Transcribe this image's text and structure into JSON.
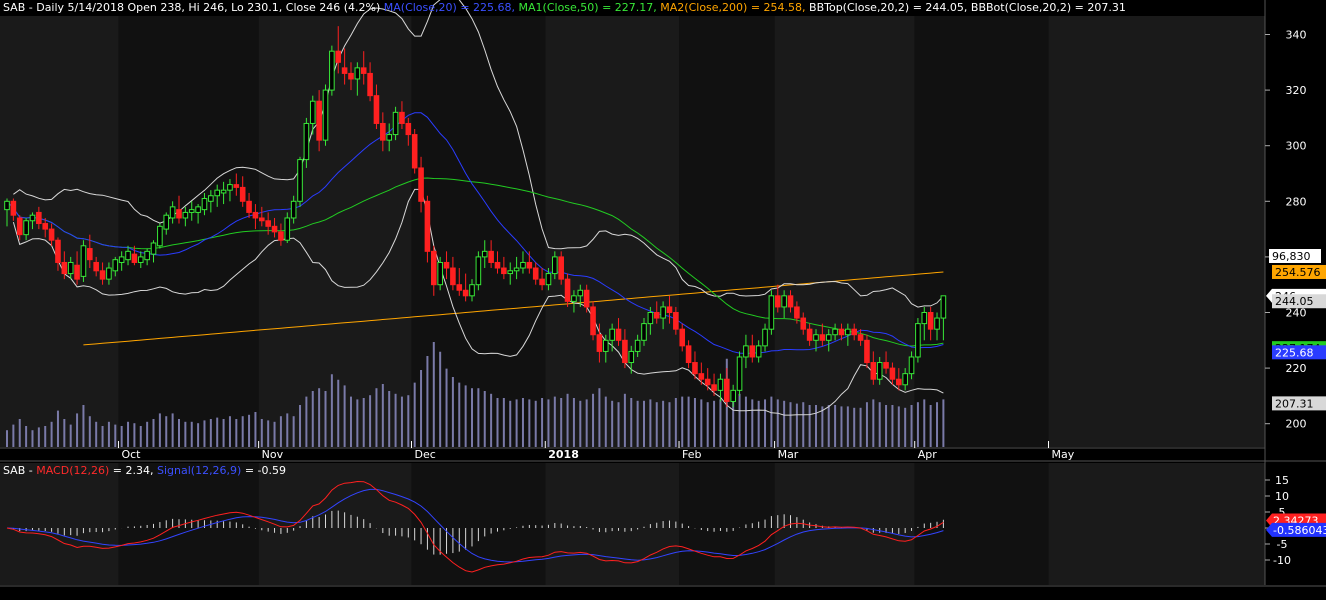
{
  "header": {
    "prefix": "SAB - Daily 5/14/2018 Open 238, Hi 246, Lo 230.1, Close 246 (4.2%) ",
    "ma": "MA(Close,20) = 225.68,",
    "ma1": " MA1(Close,50) = 227.17,",
    "ma2": " MA2(Close,200) = 254.58,",
    "bbtop": " BBTop(Close,20,2) = 244.05,",
    "bbbot": " BBBot(Close,20,2) = 207.31"
  },
  "macd_header": {
    "prefix": "SAB - ",
    "macd": "MACD(12,26)",
    "macd_val": " = 2.34, ",
    "signal": "Signal(12,26,9)",
    "signal_val": " = -0.59"
  },
  "colors": {
    "background": "#000000",
    "up": "#38e838",
    "down": "#ff2020",
    "ma20": "#2a3cff",
    "ma50": "#22cc22",
    "ma200": "#ffa500",
    "bollinger": "#d8d8d8",
    "volume": "#7a7aa8",
    "macd": "#ff2020",
    "signal": "#3344ff",
    "histogram": "#d8d8d8"
  },
  "chart_data": {
    "type": "candlestick",
    "price_axis": {
      "ticks": [
        200,
        220,
        240,
        260,
        280,
        300,
        320,
        340
      ]
    },
    "x_labels": [
      {
        "i": 18,
        "label": "Oct"
      },
      {
        "i": 40,
        "label": "Nov"
      },
      {
        "i": 64,
        "label": "Dec"
      },
      {
        "i": 85,
        "label": "2018"
      },
      {
        "i": 106,
        "label": "Feb"
      },
      {
        "i": 121,
        "label": "Mar"
      },
      {
        "i": 143,
        "label": "Apr"
      },
      {
        "i": 164,
        "label": "May"
      }
    ],
    "candles": [
      [
        277,
        281,
        271,
        280,
        1.2
      ],
      [
        280,
        281,
        273,
        275,
        1.6
      ],
      [
        274,
        275,
        266,
        268,
        2.0
      ],
      [
        268,
        274,
        266,
        273,
        1.5
      ],
      [
        273,
        276,
        270,
        275,
        1.2
      ],
      [
        276,
        278,
        270,
        272,
        1.4
      ],
      [
        272,
        274,
        267,
        270,
        1.5
      ],
      [
        270,
        272,
        264,
        266,
        1.8
      ],
      [
        266,
        267,
        255,
        258,
        2.6
      ],
      [
        258,
        262,
        252,
        254,
        2.0
      ],
      [
        254,
        260,
        252,
        258,
        1.6
      ],
      [
        257,
        262,
        250,
        252,
        2.4
      ],
      [
        253,
        266,
        251,
        264,
        3.0
      ],
      [
        263,
        268,
        256,
        259,
        2.2
      ],
      [
        258,
        260,
        253,
        255,
        1.8
      ],
      [
        255,
        258,
        250,
        252,
        1.5
      ],
      [
        252,
        258,
        250,
        256,
        1.8
      ],
      [
        255,
        260,
        253,
        259,
        1.6
      ],
      [
        258,
        262,
        255,
        260,
        1.5
      ],
      [
        259,
        264,
        257,
        262,
        1.8
      ],
      [
        261,
        264,
        257,
        258,
        1.7
      ],
      [
        258,
        262,
        256,
        260,
        1.5
      ],
      [
        259,
        263,
        257,
        262,
        1.8
      ],
      [
        261,
        266,
        258,
        265,
        2.0
      ],
      [
        264,
        272,
        263,
        271,
        2.4
      ],
      [
        270,
        276,
        268,
        275,
        2.2
      ],
      [
        274,
        280,
        272,
        278,
        2.4
      ],
      [
        277,
        282,
        272,
        274,
        2.0
      ],
      [
        274,
        278,
        271,
        276,
        1.8
      ],
      [
        276,
        280,
        273,
        277,
        1.8
      ],
      [
        276,
        279,
        272,
        278,
        1.7
      ],
      [
        277,
        283,
        275,
        281,
        1.9
      ],
      [
        280,
        284,
        276,
        282,
        2.0
      ],
      [
        282,
        286,
        278,
        284,
        2.1
      ],
      [
        283,
        287,
        279,
        284,
        2.0
      ],
      [
        284,
        288,
        280,
        286,
        2.2
      ],
      [
        286,
        290,
        282,
        285,
        2.0
      ],
      [
        285,
        289,
        278,
        280,
        2.2
      ],
      [
        280,
        283,
        274,
        276,
        2.3
      ],
      [
        276,
        279,
        270,
        274,
        2.5
      ],
      [
        274,
        278,
        271,
        273,
        2.0
      ],
      [
        273,
        276,
        268,
        271,
        1.9
      ],
      [
        271,
        274,
        267,
        269,
        1.8
      ],
      [
        269,
        272,
        264,
        266,
        2.2
      ],
      [
        266,
        276,
        265,
        274,
        2.4
      ],
      [
        274,
        282,
        272,
        280,
        2.2
      ],
      [
        280,
        296,
        278,
        295,
        3.0
      ],
      [
        295,
        310,
        292,
        308,
        3.6
      ],
      [
        308,
        318,
        304,
        316,
        4.0
      ],
      [
        316,
        320,
        298,
        302,
        4.2
      ],
      [
        302,
        322,
        300,
        320,
        4.0
      ],
      [
        320,
        336,
        318,
        334,
        5.2
      ],
      [
        334,
        343,
        326,
        330,
        4.8
      ],
      [
        328,
        335,
        322,
        326,
        4.4
      ],
      [
        326,
        330,
        320,
        324,
        3.6
      ],
      [
        324,
        330,
        318,
        328,
        3.4
      ],
      [
        328,
        334,
        322,
        326,
        3.5
      ],
      [
        326,
        330,
        316,
        318,
        3.7
      ],
      [
        318,
        322,
        306,
        308,
        4.2
      ],
      [
        308,
        312,
        298,
        302,
        4.5
      ],
      [
        302,
        308,
        298,
        304,
        4.0
      ],
      [
        304,
        314,
        302,
        312,
        3.8
      ],
      [
        312,
        316,
        306,
        308,
        3.6
      ],
      [
        308,
        310,
        300,
        304,
        3.7
      ],
      [
        304,
        306,
        290,
        292,
        4.6
      ],
      [
        292,
        296,
        276,
        280,
        5.5
      ],
      [
        280,
        282,
        258,
        262,
        6.5
      ],
      [
        262,
        264,
        246,
        250,
        7.5
      ],
      [
        250,
        260,
        248,
        258,
        6.8
      ],
      [
        258,
        262,
        252,
        256,
        5.6
      ],
      [
        256,
        260,
        248,
        250,
        5.0
      ],
      [
        250,
        256,
        246,
        248,
        4.6
      ],
      [
        248,
        254,
        244,
        246,
        4.4
      ],
      [
        246,
        252,
        244,
        250,
        4.2
      ],
      [
        250,
        262,
        248,
        260,
        4.2
      ],
      [
        260,
        266,
        256,
        262,
        4.0
      ],
      [
        262,
        266,
        256,
        258,
        3.8
      ],
      [
        258,
        262,
        254,
        256,
        3.5
      ],
      [
        256,
        260,
        252,
        254,
        3.5
      ],
      [
        254,
        258,
        250,
        255,
        3.3
      ],
      [
        255,
        260,
        252,
        256,
        3.4
      ],
      [
        256,
        262,
        254,
        258,
        3.5
      ],
      [
        258,
        262,
        254,
        256,
        3.4
      ],
      [
        256,
        258,
        250,
        252,
        3.3
      ],
      [
        252,
        256,
        248,
        250,
        3.5
      ],
      [
        250,
        256,
        248,
        254,
        3.4
      ],
      [
        254,
        262,
        252,
        260,
        3.6
      ],
      [
        260,
        262,
        250,
        252,
        3.5
      ],
      [
        252,
        254,
        242,
        244,
        3.8
      ],
      [
        244,
        248,
        240,
        246,
        3.5
      ],
      [
        246,
        250,
        242,
        248,
        3.3
      ],
      [
        248,
        250,
        240,
        242,
        3.4
      ],
      [
        242,
        244,
        230,
        232,
        3.8
      ],
      [
        232,
        236,
        222,
        226,
        4.2
      ],
      [
        226,
        232,
        222,
        230,
        3.6
      ],
      [
        230,
        236,
        226,
        234,
        3.3
      ],
      [
        234,
        238,
        228,
        230,
        3.2
      ],
      [
        230,
        234,
        220,
        222,
        3.8
      ],
      [
        222,
        228,
        218,
        226,
        3.5
      ],
      [
        226,
        232,
        224,
        230,
        3.3
      ],
      [
        230,
        238,
        228,
        236,
        3.3
      ],
      [
        236,
        242,
        232,
        240,
        3.4
      ],
      [
        240,
        244,
        236,
        238,
        3.2
      ],
      [
        238,
        244,
        234,
        242,
        3.3
      ],
      [
        242,
        246,
        236,
        240,
        3.2
      ],
      [
        240,
        242,
        232,
        234,
        3.5
      ],
      [
        234,
        236,
        226,
        228,
        3.6
      ],
      [
        228,
        230,
        220,
        222,
        3.6
      ],
      [
        222,
        226,
        216,
        218,
        3.5
      ],
      [
        218,
        222,
        214,
        216,
        3.4
      ],
      [
        216,
        220,
        212,
        214,
        3.2
      ],
      [
        214,
        218,
        210,
        212,
        3.3
      ],
      [
        212,
        218,
        208,
        216,
        3.4
      ],
      [
        216,
        220,
        206,
        208,
        6.3
      ],
      [
        208,
        214,
        206,
        212,
        3.6
      ],
      [
        212,
        226,
        210,
        224,
        3.8
      ],
      [
        224,
        232,
        220,
        228,
        3.6
      ],
      [
        228,
        232,
        222,
        224,
        3.4
      ],
      [
        224,
        230,
        222,
        228,
        3.3
      ],
      [
        228,
        236,
        226,
        234,
        3.4
      ],
      [
        234,
        248,
        232,
        246,
        3.6
      ],
      [
        246,
        250,
        240,
        242,
        3.4
      ],
      [
        242,
        248,
        238,
        246,
        3.3
      ],
      [
        246,
        248,
        240,
        242,
        3.2
      ],
      [
        242,
        244,
        236,
        238,
        3.1
      ],
      [
        238,
        240,
        232,
        234,
        3.2
      ],
      [
        234,
        236,
        228,
        230,
        3.0
      ],
      [
        230,
        234,
        226,
        232,
        3.0
      ],
      [
        232,
        236,
        228,
        230,
        2.9
      ],
      [
        230,
        234,
        226,
        232,
        3.0
      ],
      [
        232,
        236,
        230,
        234,
        3.0
      ],
      [
        234,
        236,
        230,
        232,
        2.9
      ],
      [
        232,
        236,
        228,
        234,
        2.9
      ],
      [
        234,
        236,
        230,
        232,
        2.8
      ],
      [
        232,
        234,
        228,
        230,
        2.8
      ],
      [
        230,
        232,
        220,
        222,
        3.2
      ],
      [
        222,
        226,
        214,
        216,
        3.4
      ],
      [
        216,
        224,
        214,
        222,
        3.2
      ],
      [
        222,
        226,
        218,
        220,
        3.0
      ],
      [
        220,
        222,
        214,
        216,
        3.0
      ],
      [
        216,
        220,
        212,
        214,
        2.9
      ],
      [
        214,
        220,
        212,
        218,
        2.8
      ],
      [
        218,
        226,
        216,
        224,
        3.0
      ],
      [
        224,
        238,
        222,
        236,
        3.2
      ],
      [
        236,
        242,
        230,
        240,
        3.4
      ],
      [
        240,
        242,
        230,
        234,
        3.0
      ],
      [
        234,
        240,
        230,
        238,
        3.2
      ],
      [
        238,
        246,
        230,
        246,
        3.4
      ]
    ],
    "volume_max_label": "96,830",
    "last_values": {
      "ma200": 254.576,
      "close": 246,
      "bbtop": 244.05,
      "ma50": 227.174,
      "ma20": 225.68,
      "bbbot": 207.31
    },
    "last_value_labels": {
      "ma200": "254.576",
      "close": "246",
      "bbtop": "244.05",
      "ma50": "227.174",
      "ma20": "225.68",
      "bbbot": "207.31"
    },
    "macd_axis": {
      "ticks": [
        15,
        10,
        5,
        0,
        -5,
        -10
      ]
    },
    "macd_last": {
      "macd": 2.34273,
      "signal": -0.586043
    },
    "macd_last_labels": {
      "macd": "2.34273",
      "signal": "-0.586043"
    }
  }
}
